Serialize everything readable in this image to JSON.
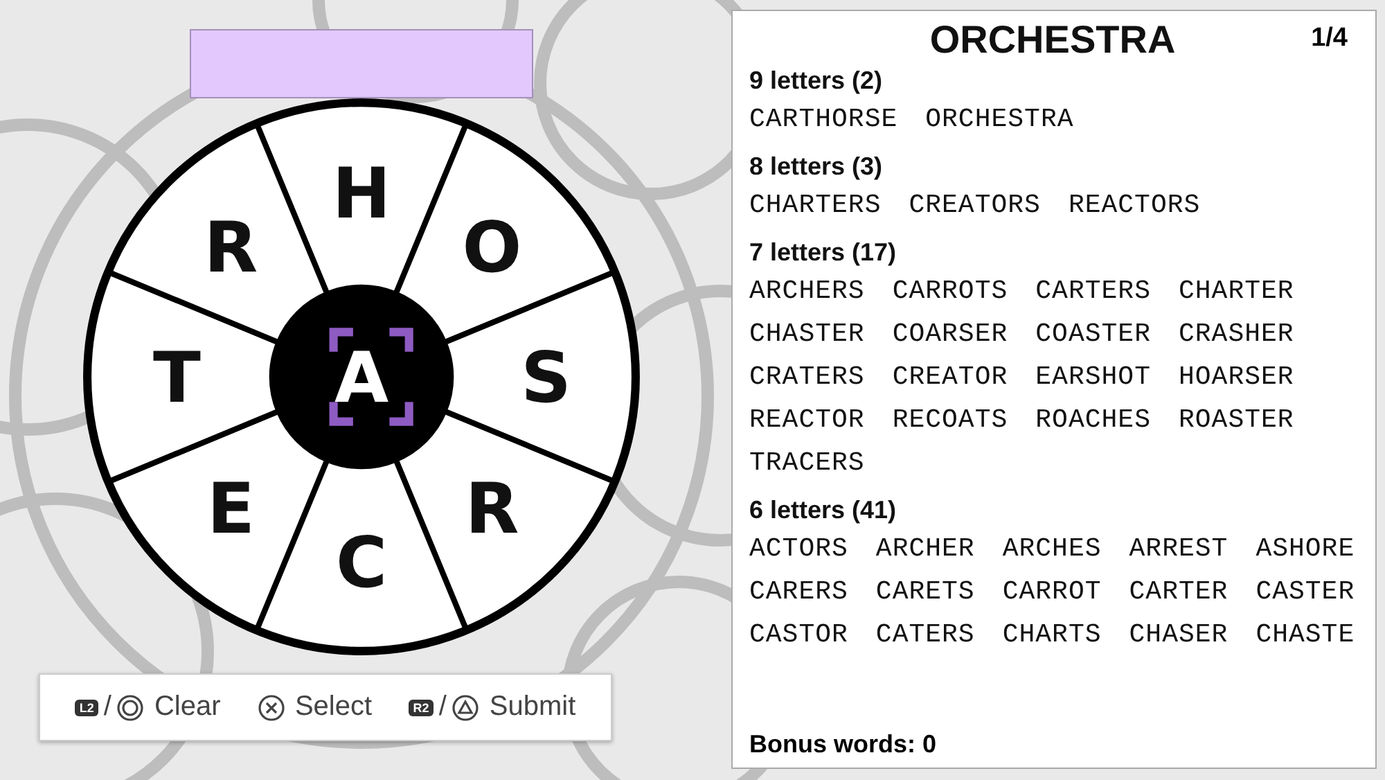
{
  "wheel": {
    "outer_letters": [
      {
        "letter": "H"
      },
      {
        "letter": "O"
      },
      {
        "letter": "S"
      },
      {
        "letter": "R"
      },
      {
        "letter": "C"
      },
      {
        "letter": "E"
      },
      {
        "letter": "T"
      },
      {
        "letter": "R"
      }
    ],
    "center": {
      "letter": "A",
      "selected": true
    }
  },
  "controls": [
    {
      "badge": "L2",
      "separator": "/",
      "kind": "circle",
      "label": "Clear"
    },
    {
      "kind": "cross",
      "label": "Select"
    },
    {
      "badge": "R2",
      "separator": "/",
      "kind": "triangle",
      "label": "Submit"
    }
  ],
  "panel": {
    "title": "ORCHESTRA",
    "page": "1/4",
    "groups": [
      {
        "heading": "9 letters (2)",
        "words": [
          "CARTHORSE",
          "ORCHESTRA"
        ]
      },
      {
        "heading": "8 letters (3)",
        "words": [
          "CHARTERS",
          "CREATORS",
          "REACTORS"
        ]
      },
      {
        "heading": "7 letters (17)",
        "words": [
          "ARCHERS",
          "CARROTS",
          "CARTERS",
          "CHARTER",
          "CHASTER",
          "COARSER",
          "COASTER",
          "CRASHER",
          "CRATERS",
          "CREATOR",
          "EARSHOT",
          "HOARSER",
          "REACTOR",
          "RECOATS",
          "ROACHES",
          "ROASTER",
          "TRACERS"
        ]
      },
      {
        "heading": "6 letters (41)",
        "words": [
          "ACTORS",
          "ARCHER",
          "ARCHES",
          "ARREST",
          "ASHORE",
          "CARERS",
          "CARETS",
          "CARROT",
          "CARTER",
          "CASTER",
          "CASTOR",
          "CATERS",
          "CHARTS",
          "CHASER",
          "CHASTE"
        ]
      }
    ],
    "bonus": "Bonus words: 0"
  }
}
